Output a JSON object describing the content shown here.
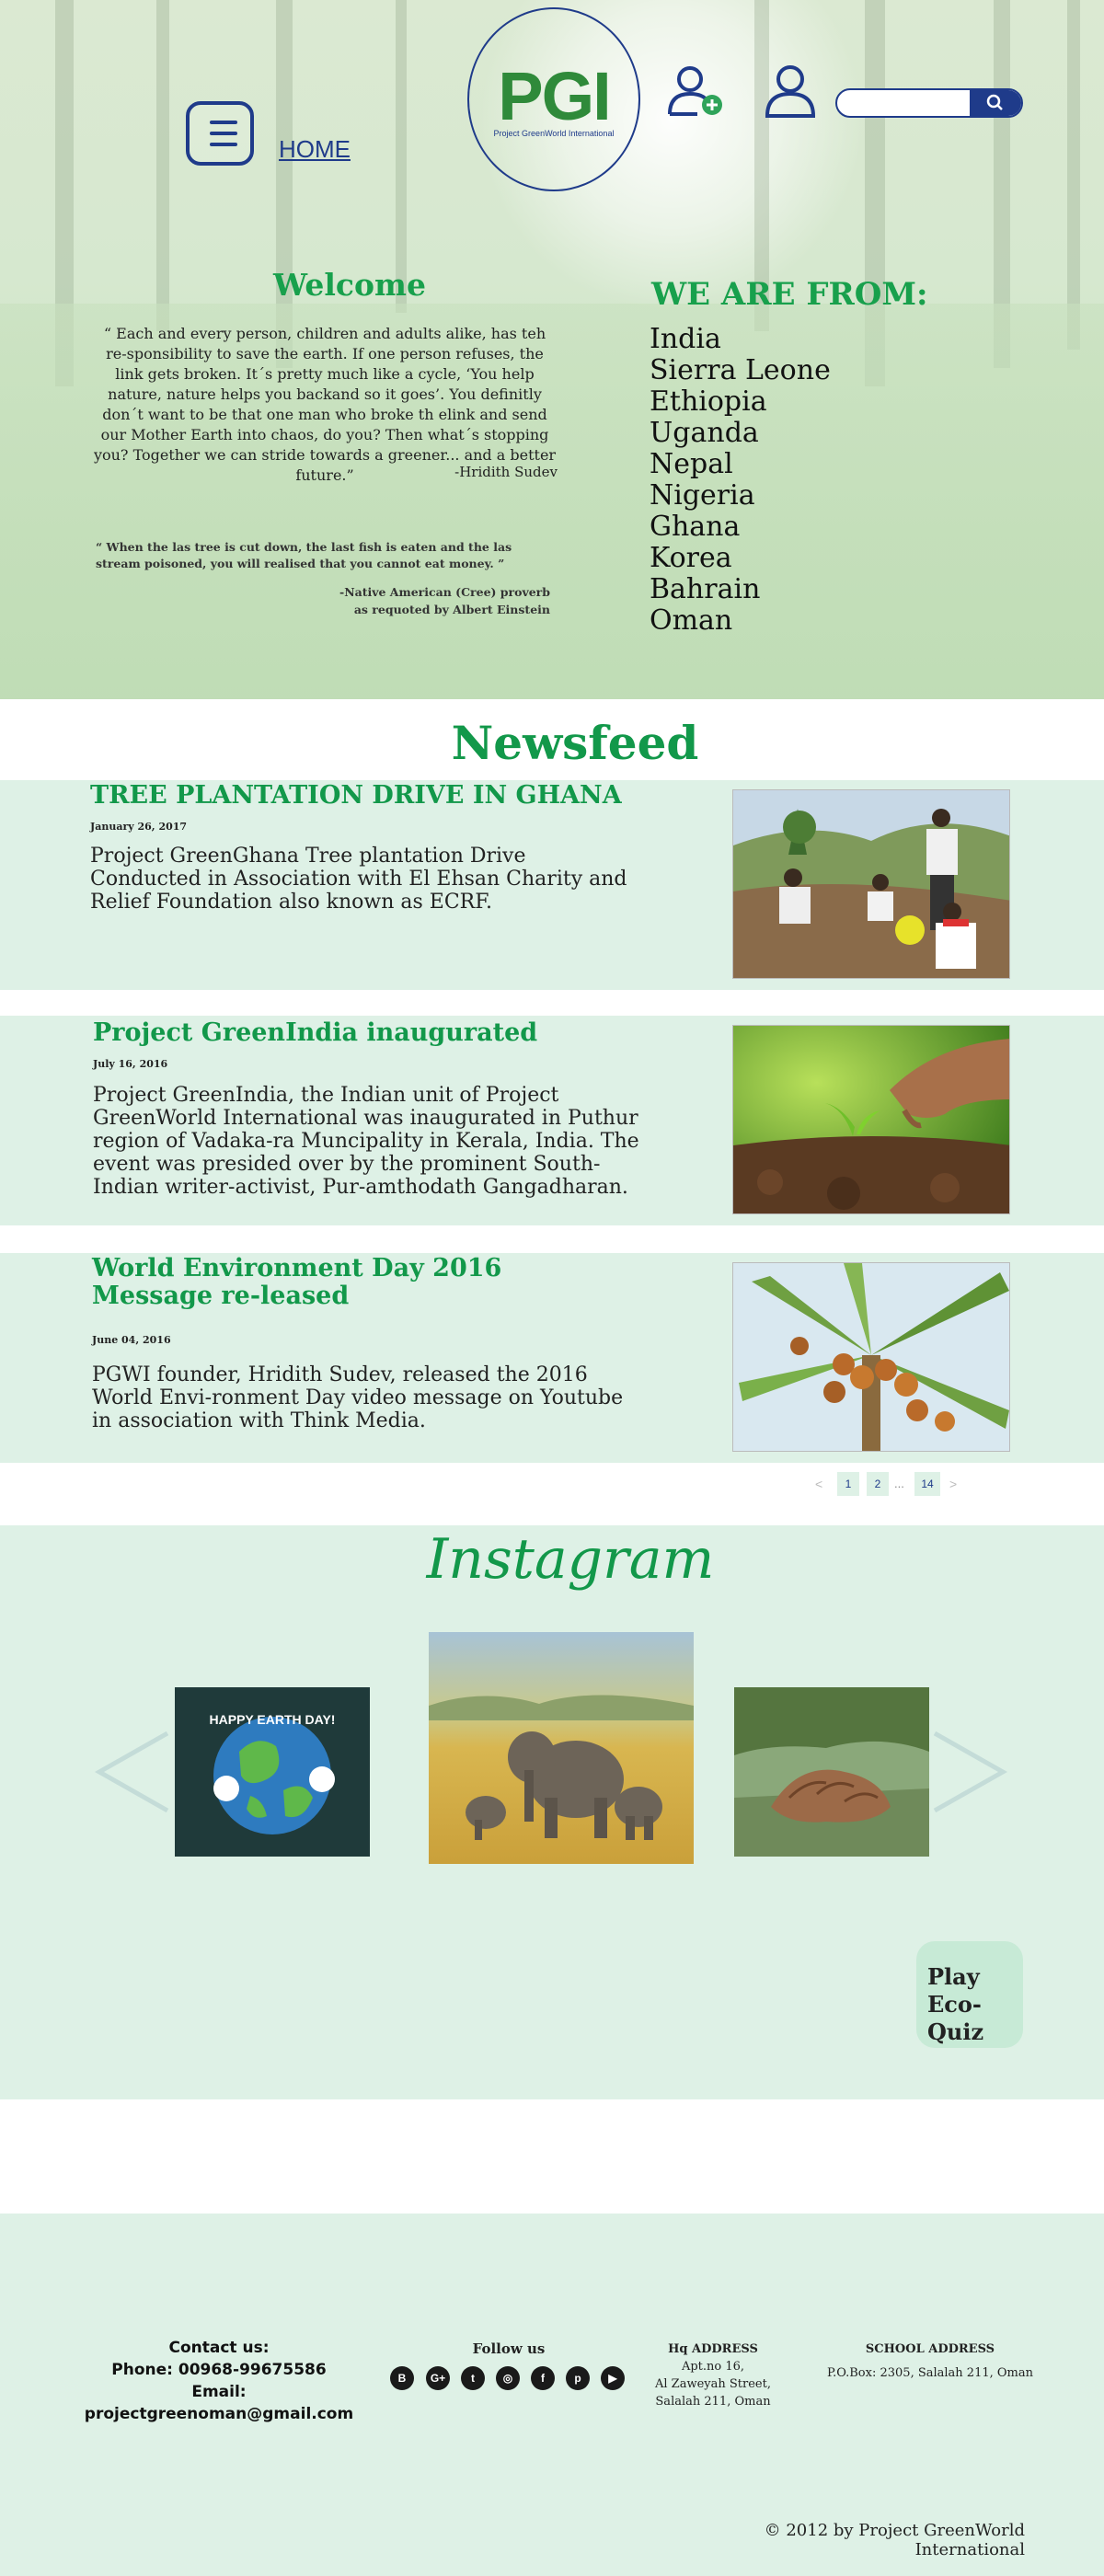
{
  "header": {
    "home_label": "HOME",
    "logo_text": "PGI",
    "logo_subtitle": "Project GreenWorld International"
  },
  "welcome": {
    "title": "Welcome",
    "quote": "“ Each and every person, children and adults alike, has teh re-sponsibility to save the earth. If one person refuses, the link gets broken. It´s pretty much like a cycle, ‘You help nature, nature helps you backand so it goes’. You definitly don´t want to be that one man who broke th elink and send our Mother Earth into chaos, do you? Then what´s stopping you? Together we can stride towards a greener... and a better future.”",
    "author": "-Hridith Sudev",
    "proverb": "“ When the las tree is cut down, the last fish is eaten and the las stream poisoned, you will realised that you cannot eat money. ”",
    "proverb_source_1": "-Native American (Cree) proverb",
    "proverb_source_2": "as requoted by Albert Einstein"
  },
  "from": {
    "title": "WE ARE FROM:",
    "countries": [
      "India",
      "Sierra Leone",
      "Ethiopia",
      "Uganda",
      "Nepal",
      "Nigeria",
      "Ghana",
      "Korea",
      "Bahrain",
      "Oman"
    ]
  },
  "newsfeed": {
    "title": "Newsfeed",
    "posts": [
      {
        "title": "TREE PLANTATION DRIVE IN GHANA",
        "date": "January 26, 2017",
        "body": "Project GreenGhana Tree plantation Drive Conducted in Association with El Ehsan Charity and Relief Foundation also known as ECRF."
      },
      {
        "title": "Project GreenIndia inaugurated",
        "date": "July 16, 2016",
        "body": "Project GreenIndia, the Indian unit of Project GreenWorld International was inaugurated in Puthur region of Vadaka-ra Muncipality in Kerala, India. The event was presided over by the prominent South-Indian writer-activist, Pur-amthodath Gangadharan."
      },
      {
        "title": "World Environment Day 2016 Message re-leased",
        "date": "June 04, 2016",
        "body": "PGWI founder, Hridith Sudev, released the 2016 World Envi-ronment Day video message on Youtube in association with Think Media."
      }
    ],
    "pagination": [
      "1",
      "2",
      "...",
      "14"
    ],
    "pagination_prev": "<",
    "pagination_next": ">"
  },
  "instagram": {
    "title": "Instagram",
    "earth_day_text": "HAPPY EARTH DAY!",
    "quiz_line1": "Play",
    "quiz_line2": "Eco-Quiz"
  },
  "footer": {
    "contact_heading": "Contact us:",
    "phone": "Phone: 00968-99675586",
    "email": "Email: projectgreenoman@gmail.com",
    "follow_heading": "Follow us",
    "social": [
      "B",
      "G+",
      "t",
      "◎",
      "f",
      "p",
      "▶"
    ],
    "hq_heading": "Hq ADDRESS",
    "hq_line1": "Apt.no 16,",
    "hq_line2": "Al Zaweyah Street,",
    "hq_line3": "Salalah 211, Oman",
    "school_heading": "SCHOOL ADDRESS",
    "school_line": "P.O.Box: 2305, Salalah 211, Oman",
    "copyright": "© 2012 by Project GreenWorld International"
  },
  "colors": {
    "brand_green": "#12984a",
    "brand_blue": "#1f3b8a",
    "mint_panel": "#def1e6"
  }
}
